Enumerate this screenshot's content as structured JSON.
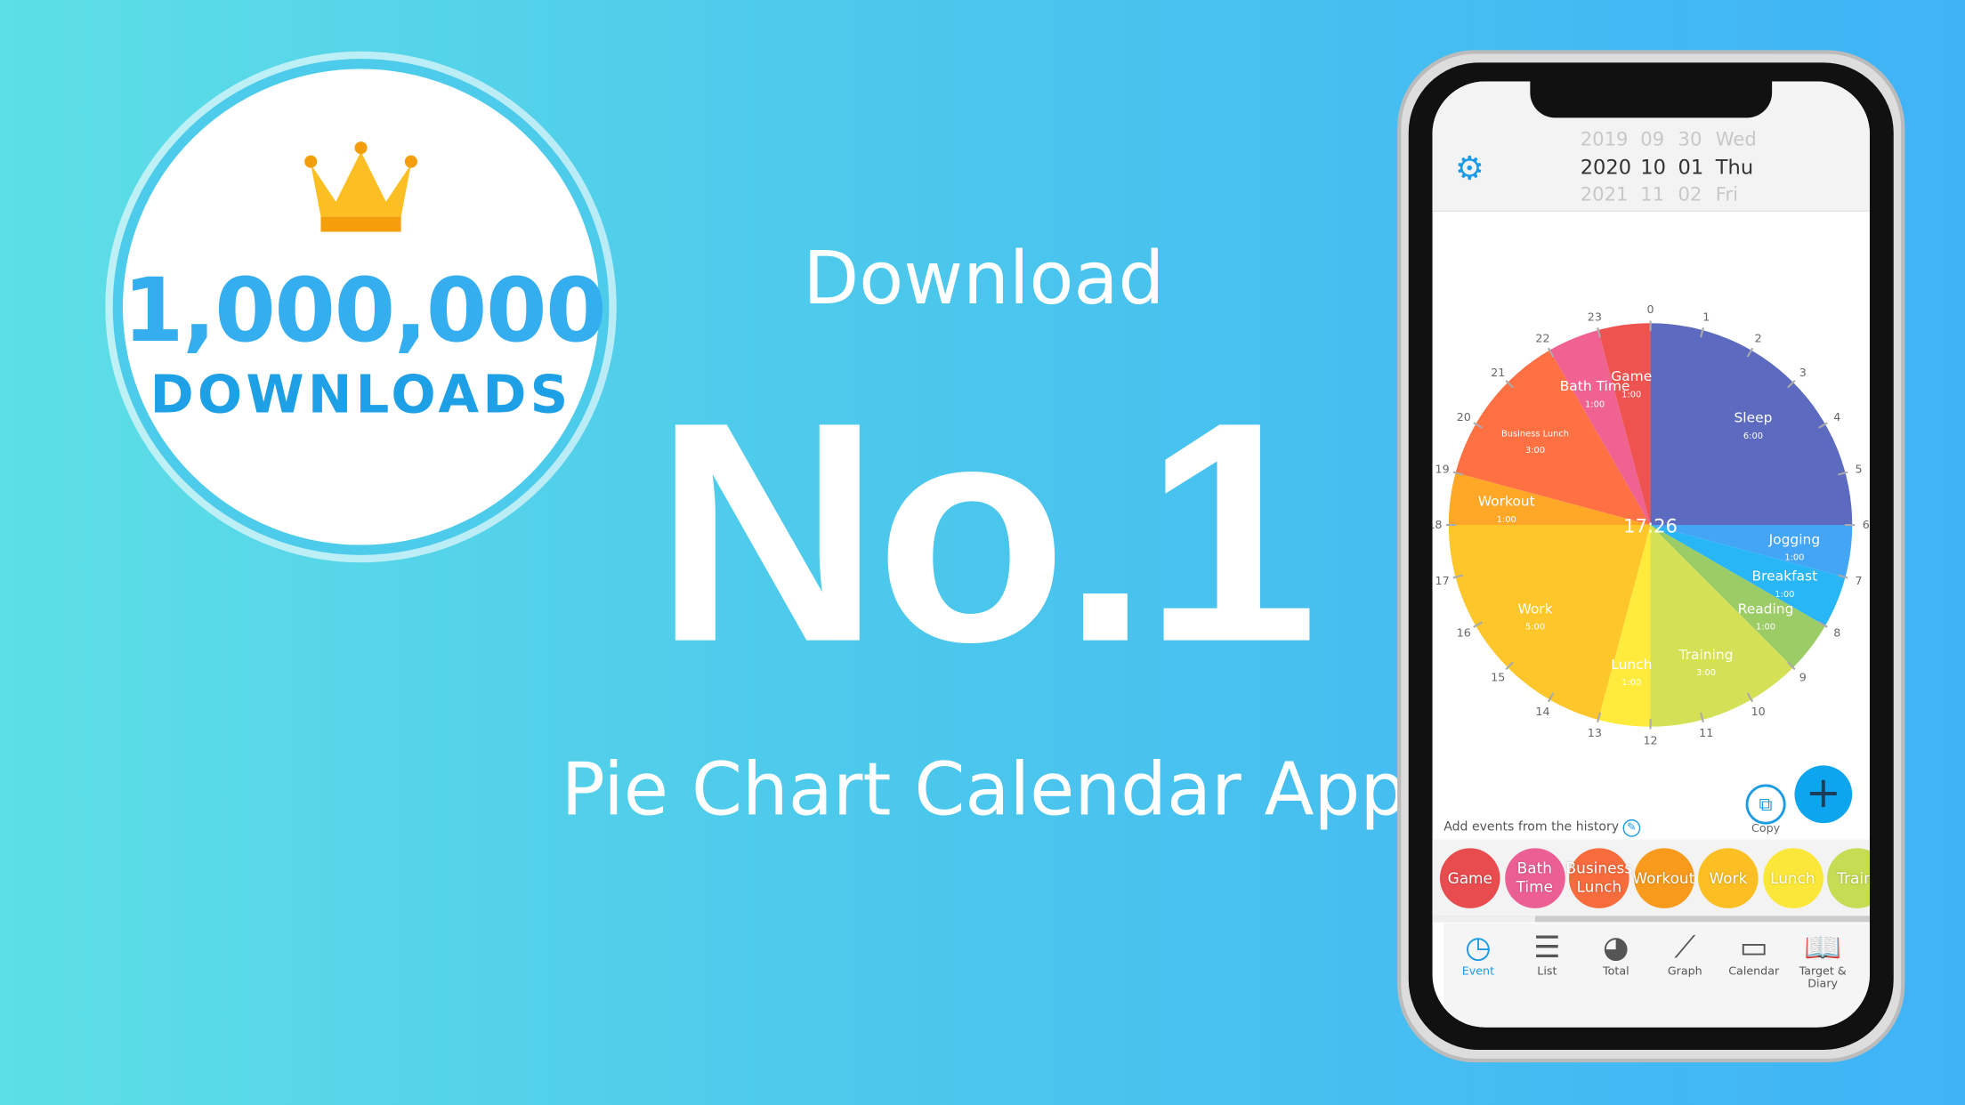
{
  "badge": {
    "count": "1,000,000",
    "label": "DOWNLOADS",
    "icon": "crown-icon"
  },
  "hero": {
    "download": "Download",
    "rank": "No.1",
    "subtitle": "Pie Chart Calendar App"
  },
  "app": {
    "date_picker": {
      "rows": [
        [
          "2019",
          "09",
          "30",
          "Wed"
        ],
        [
          "2020",
          "10",
          "01",
          "Thu"
        ],
        [
          "2021",
          "11",
          "02",
          "Fri"
        ]
      ],
      "selected_index": 1
    },
    "settings_icon": "gear-icon",
    "current_time": "17:26",
    "history_label": "Add events from the history",
    "copy_label": "Copy",
    "chips": [
      {
        "label": "Game",
        "color": "#e84c4f"
      },
      {
        "label": "Bath Time",
        "color": "#ec5f95"
      },
      {
        "label": "Business Lunch",
        "color": "#f76c3c"
      },
      {
        "label": "Workout",
        "color": "#f89a1c"
      },
      {
        "label": "Work",
        "color": "#fbbf24"
      },
      {
        "label": "Lunch",
        "color": "#fbe73a"
      },
      {
        "label": "Traini",
        "color": "#c6dc52"
      }
    ],
    "tabs": [
      {
        "label": "Event",
        "icon": "clock-icon",
        "active": true
      },
      {
        "label": "List",
        "icon": "list-icon"
      },
      {
        "label": "Total",
        "icon": "pie-icon"
      },
      {
        "label": "Graph",
        "icon": "graph-icon"
      },
      {
        "label": "Calendar",
        "icon": "calendar-icon"
      },
      {
        "label": "Target & Diary",
        "icon": "book-icon"
      }
    ],
    "accent": "#1a9be6"
  },
  "chart_data": {
    "type": "pie",
    "unit": "hours (24h clock)",
    "segments": [
      {
        "label": "Sleep",
        "duration": "6:00",
        "start": 0,
        "end": 6,
        "color": "#5c6bc0"
      },
      {
        "label": "Jogging",
        "duration": "1:00",
        "start": 6,
        "end": 7,
        "color": "#42a5f5"
      },
      {
        "label": "Breakfast",
        "duration": "1:00",
        "start": 7,
        "end": 8,
        "color": "#29b6f6"
      },
      {
        "label": "Reading",
        "duration": "1:00",
        "start": 8,
        "end": 9,
        "color": "#9ccc65"
      },
      {
        "label": "Training",
        "duration": "3:00",
        "start": 9,
        "end": 12,
        "color": "#d4e157"
      },
      {
        "label": "Lunch",
        "duration": "1:00",
        "start": 12,
        "end": 13,
        "color": "#ffeb3b"
      },
      {
        "label": "Work",
        "duration": "5:00",
        "start": 13,
        "end": 18,
        "color": "#fdc62a"
      },
      {
        "label": "Workout",
        "duration": "1:00",
        "start": 18,
        "end": 19,
        "color": "#ffa726"
      },
      {
        "label": "Business Lunch",
        "duration": "3:00",
        "start": 19,
        "end": 22,
        "color": "#ff7043"
      },
      {
        "label": "Bath Time",
        "duration": "1:00",
        "start": 22,
        "end": 23,
        "color": "#f06292"
      },
      {
        "label": "Game",
        "duration": "1:00",
        "start": 23,
        "end": 24,
        "color": "#ef5350"
      }
    ],
    "hour_ticks": [
      "0",
      "1",
      "2",
      "3",
      "4",
      "5",
      "6",
      "7",
      "8",
      "9",
      "10",
      "11",
      "12",
      "13",
      "14",
      "15",
      "16",
      "17",
      "18",
      "19",
      "20",
      "21",
      "22",
      "23"
    ]
  }
}
